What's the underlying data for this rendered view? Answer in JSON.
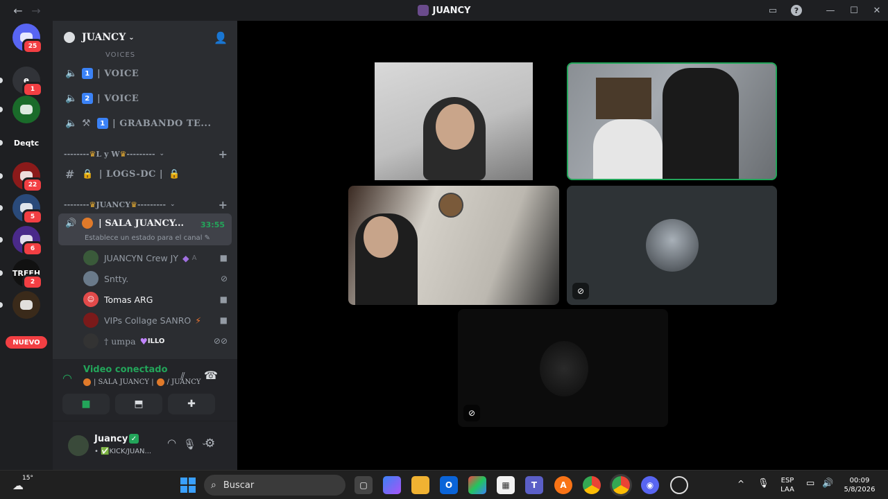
{
  "window": {
    "title": "JUANCY"
  },
  "servers": [
    {
      "label": "",
      "badge": "25",
      "color": "#5865f2",
      "icon": "discord-logo-icon"
    },
    {
      "label": "e",
      "badge": "1",
      "color": "#313338",
      "icon": ""
    },
    {
      "label": "",
      "badge": "",
      "color": "#1a6b2a",
      "icon": "elgheto-server-icon"
    },
    {
      "label": "Deqtc",
      "badge": "",
      "color": "#313338",
      "icon": ""
    },
    {
      "label": "",
      "badge": "22",
      "color": "#8b1a1a",
      "icon": "ibiza-server-icon"
    },
    {
      "label": "",
      "badge": "5",
      "color": "#2a4a7a",
      "icon": "player-server-icon"
    },
    {
      "label": "",
      "badge": "6",
      "color": "#4a2a8a",
      "icon": "gw-server-icon"
    },
    {
      "label": "TREEH",
      "badge": "2",
      "color": "#111111",
      "icon": ""
    },
    {
      "label": "",
      "badge": "",
      "color": "#3a2a1a",
      "icon": "crown-server-icon"
    }
  ],
  "new_label": "NUEVO",
  "guild": {
    "name": "JUANCY"
  },
  "channels": [
    {
      "label": "| VOICE",
      "emoji": "1"
    },
    {
      "label": "| VOICE",
      "emoji": "2"
    },
    {
      "label": "| GRABANDO TE...",
      "emoji": "1"
    }
  ],
  "category_lyw": "L y W",
  "text_channel": {
    "label": "| LOGS-DC |"
  },
  "category_juancy": "JUANCY",
  "active_channel": {
    "label": "| SALA JUANCY...",
    "timer": "33:55",
    "status": "Establece un estado para el canal"
  },
  "members": [
    {
      "name": "JUANCYN Crew JY",
      "tag": "A",
      "color": "#3a5a3a"
    },
    {
      "name": "Sntty.",
      "tag": "",
      "color": "#6a7a8a"
    },
    {
      "name": "Tomas ARG",
      "tag": "",
      "color": "#e24a4a"
    },
    {
      "name": "VIPs Collage SANRO",
      "tag": "",
      "color": "#7a1a1a"
    },
    {
      "name": "† umpa",
      "tag": "ILLO",
      "color": "#333333"
    }
  ],
  "voice": {
    "status": "Video conectado",
    "location": "| SALA JUANCY | ",
    "guild": "/ JUANCY"
  },
  "user": {
    "name": "Juancy",
    "status": "• ✅KICK/JUAN..."
  },
  "taskbar": {
    "temp": "15°",
    "search_placeholder": "Buscar",
    "lang1": "ESP",
    "lang2": "LAA",
    "time": "00:09",
    "date": "5/8/2026"
  },
  "colors": {
    "accent": "#5865f2",
    "green": "#23a55a",
    "red": "#f23f43"
  }
}
